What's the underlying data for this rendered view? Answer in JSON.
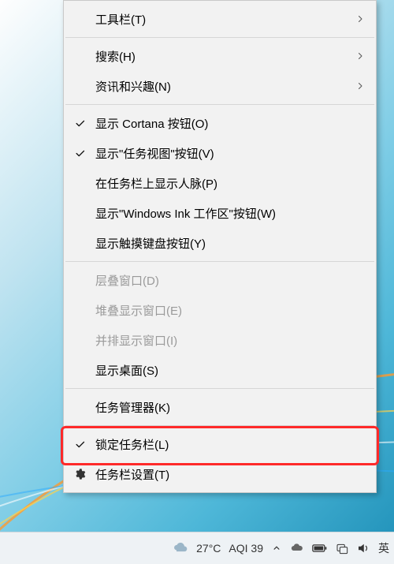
{
  "menu": {
    "groups": [
      [
        {
          "id": "toolbars",
          "label": "工具栏(T)",
          "checked": false,
          "submenu": true,
          "disabled": false,
          "icon": ""
        }
      ],
      [
        {
          "id": "search",
          "label": "搜索(H)",
          "checked": false,
          "submenu": true,
          "disabled": false,
          "icon": ""
        },
        {
          "id": "news",
          "label": "资讯和兴趣(N)",
          "checked": false,
          "submenu": true,
          "disabled": false,
          "icon": ""
        }
      ],
      [
        {
          "id": "show-cortana",
          "label": "显示 Cortana 按钮(O)",
          "checked": true,
          "submenu": false,
          "disabled": false,
          "icon": ""
        },
        {
          "id": "show-taskview",
          "label": "显示\"任务视图\"按钮(V)",
          "checked": true,
          "submenu": false,
          "disabled": false,
          "icon": ""
        },
        {
          "id": "show-people",
          "label": "在任务栏上显示人脉(P)",
          "checked": false,
          "submenu": false,
          "disabled": false,
          "icon": ""
        },
        {
          "id": "show-ink",
          "label": "显示\"Windows Ink 工作区\"按钮(W)",
          "checked": false,
          "submenu": false,
          "disabled": false,
          "icon": ""
        },
        {
          "id": "show-touchkbd",
          "label": "显示触摸键盘按钮(Y)",
          "checked": false,
          "submenu": false,
          "disabled": false,
          "icon": ""
        }
      ],
      [
        {
          "id": "cascade",
          "label": "层叠窗口(D)",
          "checked": false,
          "submenu": false,
          "disabled": true,
          "icon": ""
        },
        {
          "id": "stacked",
          "label": "堆叠显示窗口(E)",
          "checked": false,
          "submenu": false,
          "disabled": true,
          "icon": ""
        },
        {
          "id": "sidebyside",
          "label": "并排显示窗口(I)",
          "checked": false,
          "submenu": false,
          "disabled": true,
          "icon": ""
        },
        {
          "id": "show-desktop",
          "label": "显示桌面(S)",
          "checked": false,
          "submenu": false,
          "disabled": false,
          "icon": ""
        }
      ],
      [
        {
          "id": "task-manager",
          "label": "任务管理器(K)",
          "checked": false,
          "submenu": false,
          "disabled": false,
          "icon": ""
        }
      ],
      [
        {
          "id": "lock-taskbar",
          "label": "锁定任务栏(L)",
          "checked": true,
          "submenu": false,
          "disabled": false,
          "icon": "",
          "highlight": true
        },
        {
          "id": "taskbar-settings",
          "label": "任务栏设置(T)",
          "checked": false,
          "submenu": false,
          "disabled": false,
          "icon": "gear"
        }
      ]
    ]
  },
  "taskbar": {
    "weather": {
      "temp": "27°C",
      "aqi": "AQI 39"
    },
    "ime": "英"
  }
}
